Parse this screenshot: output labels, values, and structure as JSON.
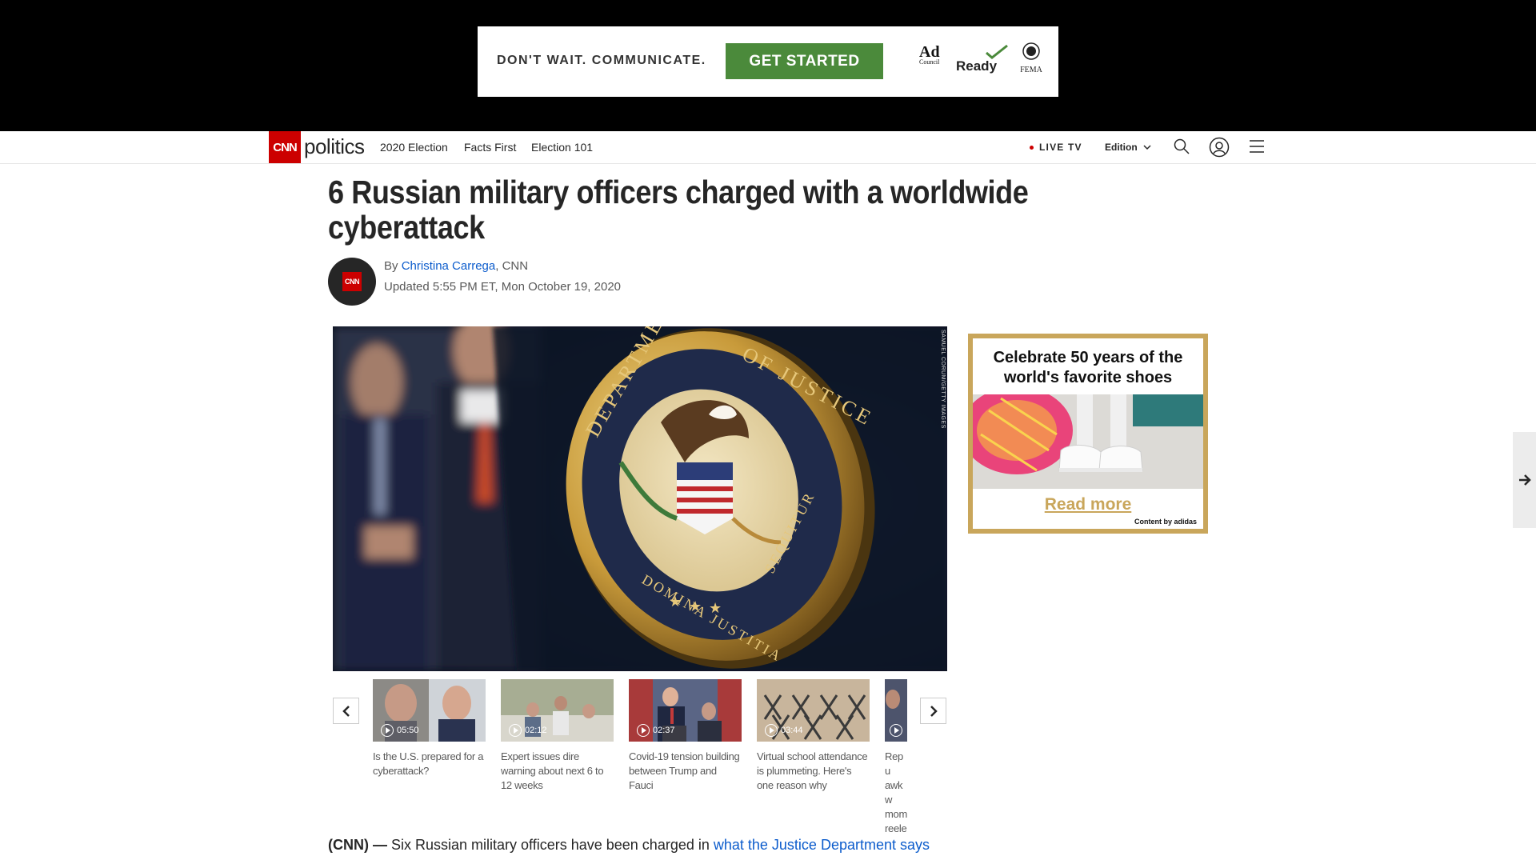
{
  "ad_banner": {
    "tagline": "DON'T WAIT. COMMUNICATE.",
    "cta": "GET STARTED",
    "adcouncil_logo": "Ad",
    "adcouncil_sub": "Council",
    "ready_logo": "Ready",
    "fema_logo": "FEMA"
  },
  "nav": {
    "logo": "CNN",
    "section": "politics",
    "links": [
      "2020 Election",
      "Facts First",
      "Election 101"
    ],
    "live_tv": "LIVE TV",
    "edition": "Edition"
  },
  "article": {
    "headline": "6 Russian military officers charged with a worldwide cyberattack",
    "byline_prefix": "By ",
    "author": "Christina Carrega",
    "byline_suffix": ", CNN",
    "avatar_logo": "CNN",
    "updated": "Updated 5:55 PM ET, Mon October 19, 2020",
    "photo_credit": "SAMUEL CORUM/GETTY IMAGES",
    "lead_source": "(CNN) —",
    "lead_text": " Six Russian military officers have been charged in ",
    "lead_link": "what the Justice Department says"
  },
  "videos": [
    {
      "duration": "05:50",
      "title": "Is the U.S. prepared for a cyberattack?"
    },
    {
      "duration": "02:12",
      "title": "Expert issues dire warning about next 6 to 12 weeks"
    },
    {
      "duration": "02:37",
      "title": "Covid-19 tension building between Trump and Fauci"
    },
    {
      "duration": "03:44",
      "title": "Virtual school attendance is plummeting. Here's one reason why"
    },
    {
      "duration": "",
      "title": "Repu awkw mom reele"
    }
  ],
  "side_ad": {
    "title": "Celebrate 50 years of the world's favorite shoes",
    "read_more": "Read more",
    "credit": "Content by adidas"
  },
  "colors": {
    "cnn_red": "#cc0000",
    "link_blue": "#0c5ccc",
    "ad_green": "#4b8a3b",
    "ad_gold": "#c9a65b"
  }
}
